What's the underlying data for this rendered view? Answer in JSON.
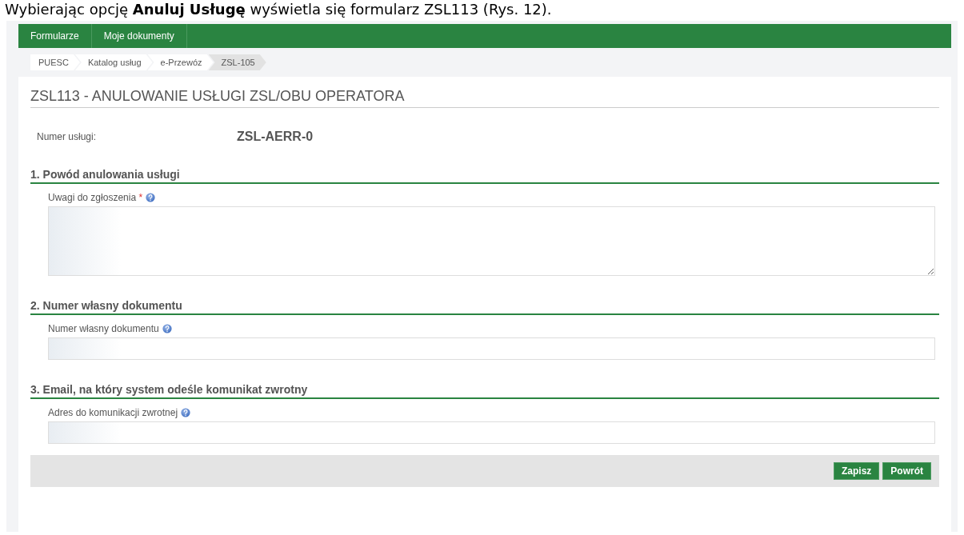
{
  "caption": "Wybierając opcję **Anuluj Usługę** wyświetla się formularz ZSL113 (Rys. 12).",
  "menu": [
    {
      "label": "Formularze"
    },
    {
      "label": "Moje dokumenty"
    }
  ],
  "breadcrumb": [
    {
      "label": "PUESC",
      "selected": false
    },
    {
      "label": "Katalog usług",
      "selected": false
    },
    {
      "label": "e-Przewóz",
      "selected": false
    },
    {
      "label": "ZSL-105",
      "selected": true
    }
  ],
  "page_title": "ZSL113 - ANULOWANIE USŁUGI ZSL/OBU OPERATORA",
  "service_number": {
    "label": "Numer usługi:",
    "value": "ZSL-AERR-0"
  },
  "sections": [
    {
      "heading": "1. Powód anulowania usługi",
      "field": {
        "kind": "textarea",
        "label": "Uwagi do zgłoszenia",
        "required_mark": "*"
      }
    },
    {
      "heading": "2. Numer własny dokumentu",
      "field": {
        "kind": "input",
        "label": "Numer własny dokumentu"
      }
    },
    {
      "heading": "3. Email, na który system odeśle komunikat zwrotny",
      "field": {
        "kind": "input",
        "label": "Adres do komunikacji zwrotnej"
      }
    }
  ],
  "buttons": [
    "Zapisz",
    "Powrót"
  ]
}
